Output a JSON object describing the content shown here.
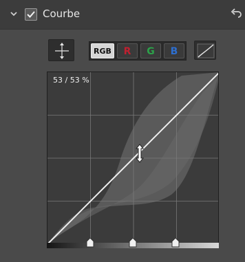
{
  "header": {
    "title": "Courbe",
    "enabled": true,
    "icons": {
      "collapse": "chevron-down-icon",
      "reset": "undo-icon"
    }
  },
  "toolbar": {
    "move_tool_icon": "move-arrows-icon",
    "channels": [
      {
        "id": "rgb",
        "label": "RGB",
        "active": true,
        "color": "#111111"
      },
      {
        "id": "r",
        "label": "R",
        "active": false,
        "color": "#c02030"
      },
      {
        "id": "g",
        "label": "G",
        "active": false,
        "color": "#2ca24a"
      },
      {
        "id": "b",
        "label": "B",
        "active": false,
        "color": "#2d6fd0"
      }
    ],
    "curve_type_icon": "linear-curve-icon"
  },
  "graph": {
    "readout": "53 / 53 %",
    "cursor_icon": "resize-vertical-icon",
    "slider_handles": 3
  }
}
